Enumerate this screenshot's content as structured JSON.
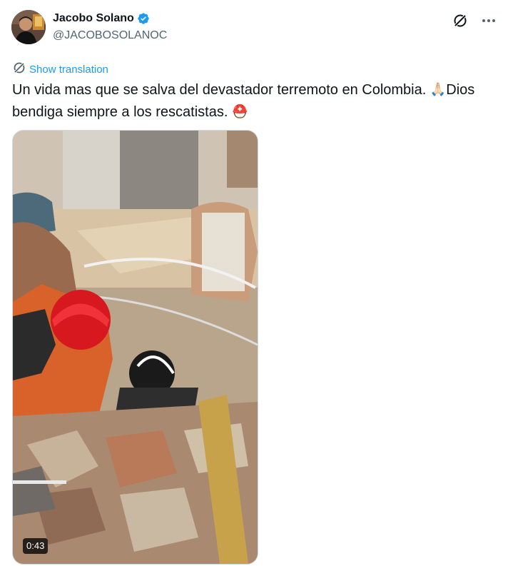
{
  "tweet": {
    "author": {
      "display_name": "Jacobo Solano",
      "handle": "@JACOBOSOLANOC",
      "verified": true,
      "avatar_icon": "avatar-photo"
    },
    "actions": {
      "grok_icon": "grok-icon",
      "more_icon": "more-icon"
    },
    "translation": {
      "label": "Show translation",
      "icon": "translate-icon"
    },
    "text_part1": "Un vida mas que se salva del devastador terremoto en Colombia. ",
    "emoji1": "🙏🏻",
    "text_part2": "Dios bendiga siempre a los rescatistas. ",
    "emoji2": "⛑️",
    "media": {
      "type": "video",
      "duration": "0:43"
    }
  },
  "colors": {
    "text": "#0f1419",
    "secondary": "#536471",
    "link": "#1d9bf0",
    "verified": "#1d9bf0",
    "border": "#cfd9de"
  }
}
